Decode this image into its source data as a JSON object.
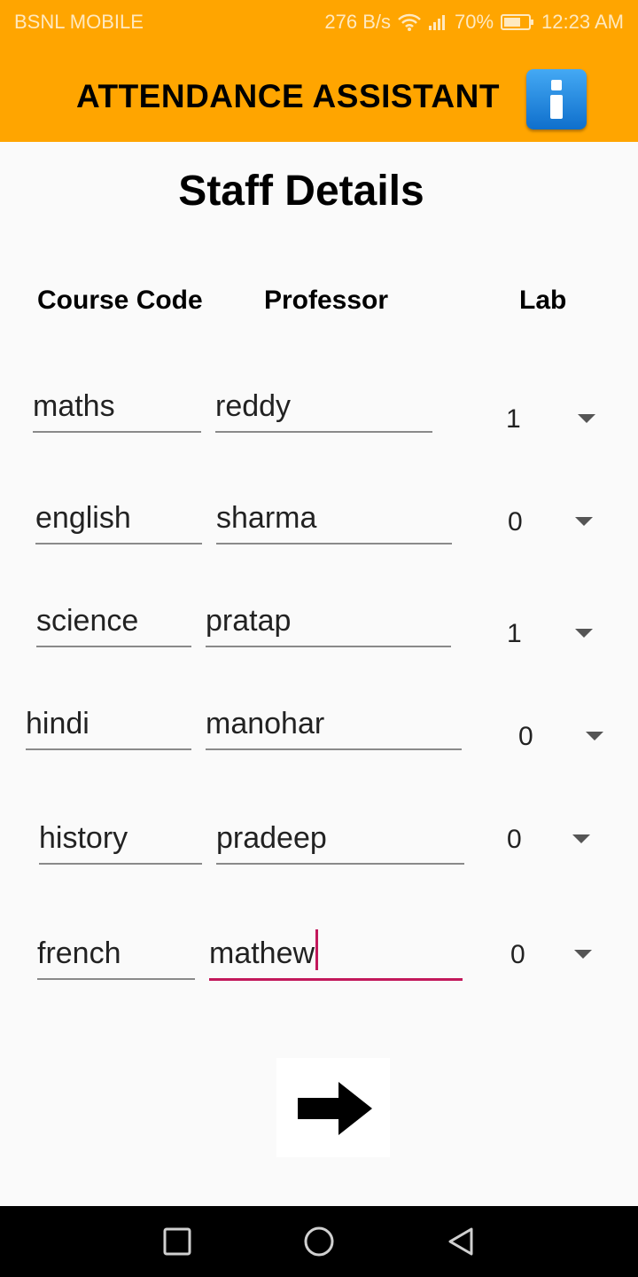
{
  "status_bar": {
    "carrier": "BSNL MOBILE",
    "speed": "276 B/s",
    "battery": "70%",
    "time": "12:23 AM",
    "icons": [
      "wifi-icon",
      "signal-icon",
      "battery-icon"
    ]
  },
  "app_bar": {
    "title": "ATTENDANCE ASSISTANT",
    "info_icon": "info-icon",
    "color": "#ffa500"
  },
  "page": {
    "title": "Staff Details",
    "headers": {
      "course": "Course Code",
      "professor": "Professor",
      "lab": "Lab"
    }
  },
  "rows": [
    {
      "course": "maths",
      "professor": "reddy",
      "lab": "1"
    },
    {
      "course": "english",
      "professor": "sharma",
      "lab": "0"
    },
    {
      "course": "science",
      "professor": "pratap",
      "lab": "1"
    },
    {
      "course": "hindi",
      "professor": "manohar",
      "lab": "0"
    },
    {
      "course": "history",
      "professor": "pradeep",
      "lab": "0"
    },
    {
      "course": "french",
      "professor": "mathew",
      "lab": "0"
    }
  ],
  "next_button_icon": "arrow-right-icon",
  "nav_bar": {
    "icons": [
      "recents-icon",
      "home-icon",
      "back-icon"
    ]
  },
  "colors": {
    "accent": "#c2185b",
    "app_bar": "#ffa500"
  }
}
